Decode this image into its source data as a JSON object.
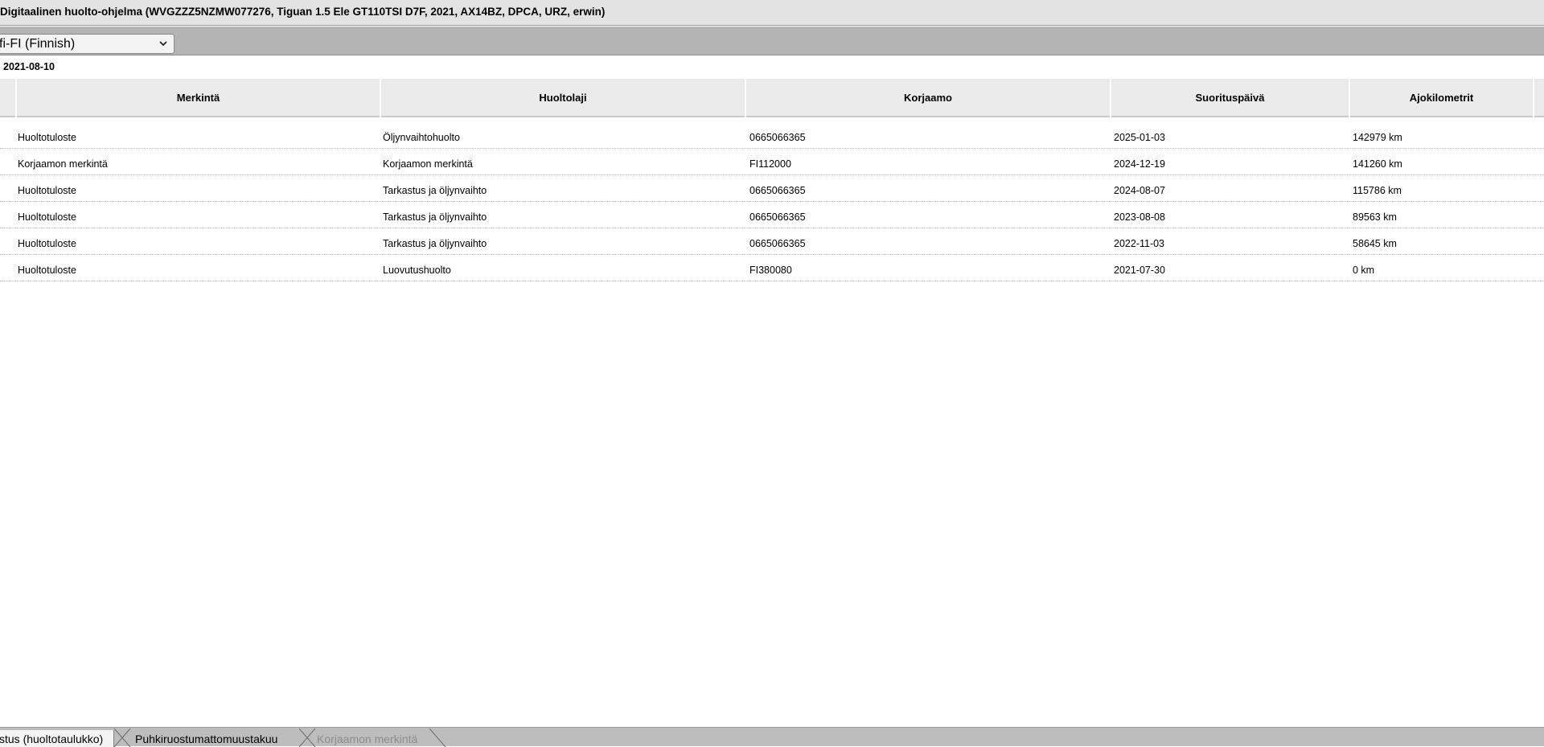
{
  "window": {
    "title": "Digitaalinen huolto-ohjelma (WVGZZZ5NZMW077276, Tiguan 1.5 Ele GT110TSI D7F, 2021, AX14BZ, DPCA, URZ, erwin)"
  },
  "language": {
    "selected": "fi-FI (Finnish)"
  },
  "header": {
    "date": "2021-08-10"
  },
  "table": {
    "columns": [
      "Merkintä",
      "Huoltolaji",
      "Korjaamo",
      "Suorituspäivä",
      "Ajokilometrit"
    ],
    "rows": [
      {
        "merkinta": "Huoltotuloste",
        "huoltolaji": "Öljynvaihtohuolto",
        "korjaamo": "0665066365",
        "paiva": "2025-01-03",
        "km": "142979 km"
      },
      {
        "merkinta": "Korjaamon merkintä",
        "huoltolaji": "Korjaamon merkintä",
        "korjaamo": "FI112000",
        "paiva": "2024-12-19",
        "km": "141260 km"
      },
      {
        "merkinta": "Huoltotuloste",
        "huoltolaji": "Tarkastus ja öljynvaihto",
        "korjaamo": "0665066365",
        "paiva": "2024-08-07",
        "km": "115786 km"
      },
      {
        "merkinta": "Huoltotuloste",
        "huoltolaji": "Tarkastus ja öljynvaihto",
        "korjaamo": "0665066365",
        "paiva": "2023-08-08",
        "km": "89563 km"
      },
      {
        "merkinta": "Huoltotuloste",
        "huoltolaji": "Tarkastus ja öljynvaihto",
        "korjaamo": "0665066365",
        "paiva": "2022-11-03",
        "km": "58645 km"
      },
      {
        "merkinta": "Huoltotuloste",
        "huoltolaji": "Luovutushuolto",
        "korjaamo": "FI380080",
        "paiva": "2021-07-30",
        "km": "0 km"
      }
    ]
  },
  "tabs": [
    {
      "label": "stus (huoltotaulukko)",
      "state": "active"
    },
    {
      "label": "Puhkiruostumattomuustakuu",
      "state": "normal"
    },
    {
      "label": "Korjaamon merkintä",
      "state": "disabled"
    }
  ],
  "colors": {
    "title_bg": "#e3e3e3",
    "toolbar_bg": "#b4b4b4",
    "header_bg": "#ebebeb",
    "tabbar_bg": "#bdbdbd",
    "disabled_text": "#8c8c8c"
  },
  "icons": {
    "language_dropdown": "chevron-down-icon"
  }
}
